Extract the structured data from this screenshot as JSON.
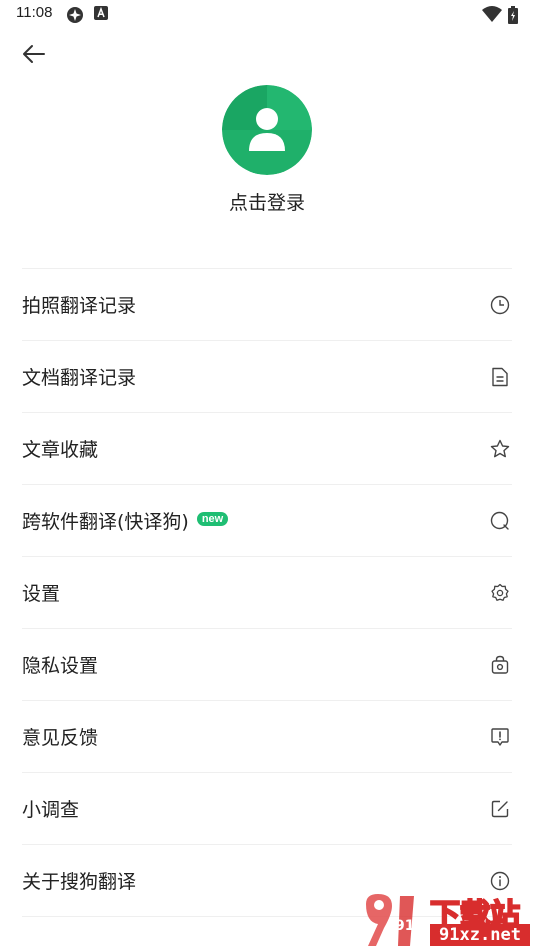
{
  "status_bar": {
    "time": "11:08"
  },
  "profile": {
    "login_label": "点击登录",
    "avatar_color": "#1fb06a"
  },
  "menu": [
    {
      "label": "拍照翻译记录",
      "icon": "clock-icon"
    },
    {
      "label": "文档翻译记录",
      "icon": "document-icon"
    },
    {
      "label": "文章收藏",
      "icon": "star-icon"
    },
    {
      "label": "跨软件翻译(快译狗)",
      "badge": "new",
      "icon": "search-chat-icon"
    },
    {
      "label": "设置",
      "icon": "gear-icon"
    },
    {
      "label": "隐私设置",
      "icon": "lock-camera-icon"
    },
    {
      "label": "意见反馈",
      "icon": "feedback-icon"
    },
    {
      "label": "小调查",
      "icon": "edit-icon"
    },
    {
      "label": "关于搜狗翻译",
      "icon": "info-icon"
    }
  ],
  "watermark": {
    "title": "下载站",
    "site": "91xz.net",
    "logo_text": "91"
  },
  "colors": {
    "accent": "#1fbe73",
    "watermark_red": "#d82d2d"
  }
}
